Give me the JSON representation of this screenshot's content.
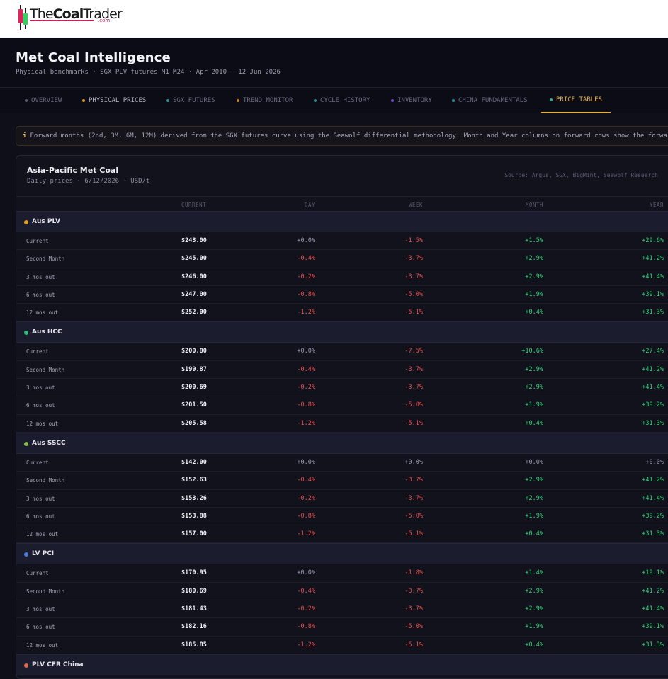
{
  "brand": {
    "name_light": "The",
    "name_bold": "Coal",
    "name_tail": "Trader",
    "suffix": ".com"
  },
  "header": {
    "title": "Met Coal Intelligence",
    "subtitle": "Physical benchmarks · SGX PLV futures M1–M24 · Apr 2010 – 12 Jun 2026"
  },
  "tabs": [
    {
      "label": "OVERVIEW",
      "dot": "#5a5a6e"
    },
    {
      "label": "PHYSICAL PRICES",
      "dot": "#d09a2a"
    },
    {
      "label": "SGX FUTURES",
      "dot": "#2a8c8c"
    },
    {
      "label": "TREND MONITOR",
      "dot": "#c07a2a"
    },
    {
      "label": "CYCLE HISTORY",
      "dot": "#2a8c8c"
    },
    {
      "label": "INVENTORY",
      "dot": "#6a4ac0"
    },
    {
      "label": "CHINA FUNDAMENTALS",
      "dot": "#2a8c8c"
    },
    {
      "label": "PRICE TABLES",
      "dot": "#2ab088"
    }
  ],
  "notice": {
    "icon": "i",
    "text": "Forward months (2nd, 3M, 6M, 12M) derived from the SGX futures curve using the Seawolf differential methodology. Month and Year columns on forward rows show the forward pr"
  },
  "panel": {
    "title": "Asia-Pacific Met Coal",
    "subtitle": "Daily prices · 6/12/2026 · USD/t",
    "source": "Source: Argus, SGX, BigMint, Seawolf Research",
    "columns": {
      "current": "CURRENT",
      "day": "DAY",
      "week": "WEEK",
      "month": "MONTH",
      "year": "YEAR"
    }
  },
  "groups": [
    {
      "name": "Aus PLV",
      "color": "#e3a020",
      "rows": [
        {
          "label": "Current",
          "current": "$243.00",
          "day": "+0.0%",
          "week": "-1.5%",
          "month": "+1.5%",
          "year": "+29.6%"
        },
        {
          "label": "Second Month",
          "current": "$245.00",
          "day": "-0.4%",
          "week": "-3.7%",
          "month": "+2.9%",
          "year": "+41.2%"
        },
        {
          "label": "3 mos out",
          "current": "$246.00",
          "day": "-0.2%",
          "week": "-3.7%",
          "month": "+2.9%",
          "year": "+41.4%"
        },
        {
          "label": "6 mos out",
          "current": "$247.00",
          "day": "-0.8%",
          "week": "-5.0%",
          "month": "+1.9%",
          "year": "+39.1%"
        },
        {
          "label": "12 mos out",
          "current": "$252.00",
          "day": "-1.2%",
          "week": "-5.1%",
          "month": "+0.4%",
          "year": "+31.3%"
        }
      ]
    },
    {
      "name": "Aus HCC",
      "color": "#2fc07a",
      "rows": [
        {
          "label": "Current",
          "current": "$200.80",
          "day": "+0.0%",
          "week": "-7.5%",
          "month": "+10.6%",
          "year": "+27.4%"
        },
        {
          "label": "Second Month",
          "current": "$199.87",
          "day": "-0.4%",
          "week": "-3.7%",
          "month": "+2.9%",
          "year": "+41.2%"
        },
        {
          "label": "3 mos out",
          "current": "$200.69",
          "day": "-0.2%",
          "week": "-3.7%",
          "month": "+2.9%",
          "year": "+41.4%"
        },
        {
          "label": "6 mos out",
          "current": "$201.50",
          "day": "-0.8%",
          "week": "-5.0%",
          "month": "+1.9%",
          "year": "+39.2%"
        },
        {
          "label": "12 mos out",
          "current": "$205.58",
          "day": "-1.2%",
          "week": "-5.1%",
          "month": "+0.4%",
          "year": "+31.3%"
        }
      ]
    },
    {
      "name": "Aus SSCC",
      "color": "#8ac050",
      "rows": [
        {
          "label": "Current",
          "current": "$142.00",
          "day": "+0.0%",
          "week": "+0.0%",
          "month": "+0.0%",
          "year": "+0.0%"
        },
        {
          "label": "Second Month",
          "current": "$152.63",
          "day": "-0.4%",
          "week": "-3.7%",
          "month": "+2.9%",
          "year": "+41.2%"
        },
        {
          "label": "3 mos out",
          "current": "$153.26",
          "day": "-0.2%",
          "week": "-3.7%",
          "month": "+2.9%",
          "year": "+41.4%"
        },
        {
          "label": "6 mos out",
          "current": "$153.88",
          "day": "-0.8%",
          "week": "-5.0%",
          "month": "+1.9%",
          "year": "+39.2%"
        },
        {
          "label": "12 mos out",
          "current": "$157.00",
          "day": "-1.2%",
          "week": "-5.1%",
          "month": "+0.4%",
          "year": "+31.3%"
        }
      ]
    },
    {
      "name": "LV PCI",
      "color": "#4a7ae0",
      "rows": [
        {
          "label": "Current",
          "current": "$170.95",
          "day": "+0.0%",
          "week": "-1.8%",
          "month": "+1.4%",
          "year": "+19.1%"
        },
        {
          "label": "Second Month",
          "current": "$180.69",
          "day": "-0.4%",
          "week": "-3.7%",
          "month": "+2.9%",
          "year": "+41.2%"
        },
        {
          "label": "3 mos out",
          "current": "$181.43",
          "day": "-0.2%",
          "week": "-3.7%",
          "month": "+2.9%",
          "year": "+41.4%"
        },
        {
          "label": "6 mos out",
          "current": "$182.16",
          "day": "-0.8%",
          "week": "-5.0%",
          "month": "+1.9%",
          "year": "+39.1%"
        },
        {
          "label": "12 mos out",
          "current": "$185.85",
          "day": "-1.2%",
          "week": "-5.1%",
          "month": "+0.4%",
          "year": "+31.3%"
        }
      ]
    },
    {
      "name": "PLV CFR China",
      "color": "#e06a4a",
      "rows": []
    }
  ]
}
